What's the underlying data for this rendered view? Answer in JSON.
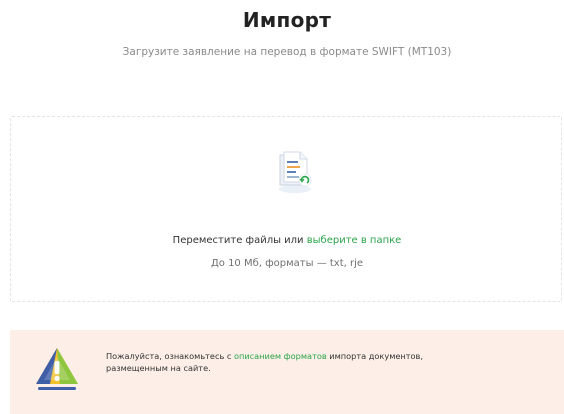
{
  "header": {
    "title": "Импорт",
    "subtitle": "Загрузите заявление на перевод в формате SWIFT (MT103)"
  },
  "dropzone": {
    "icon": "document-upload-icon",
    "text_before_link": "Переместите файлы или ",
    "link_text": "выберите в папке",
    "hint": "До 10 Мб, форматы — txt, rje"
  },
  "notice": {
    "icon": "warning-icon",
    "text_before_link": "Пожалуйста, ознакомьтесь с ",
    "link_text": "описанием форматов",
    "text_after_link": " импорта документов,",
    "text_line2": "размещенным на сайте."
  },
  "colors": {
    "link": "#2aa44a",
    "notice_background": "#fdefe7",
    "warning_yellow": "#f2c12e",
    "warning_blue": "#3f5ea8",
    "warning_green": "#8fc63f"
  }
}
